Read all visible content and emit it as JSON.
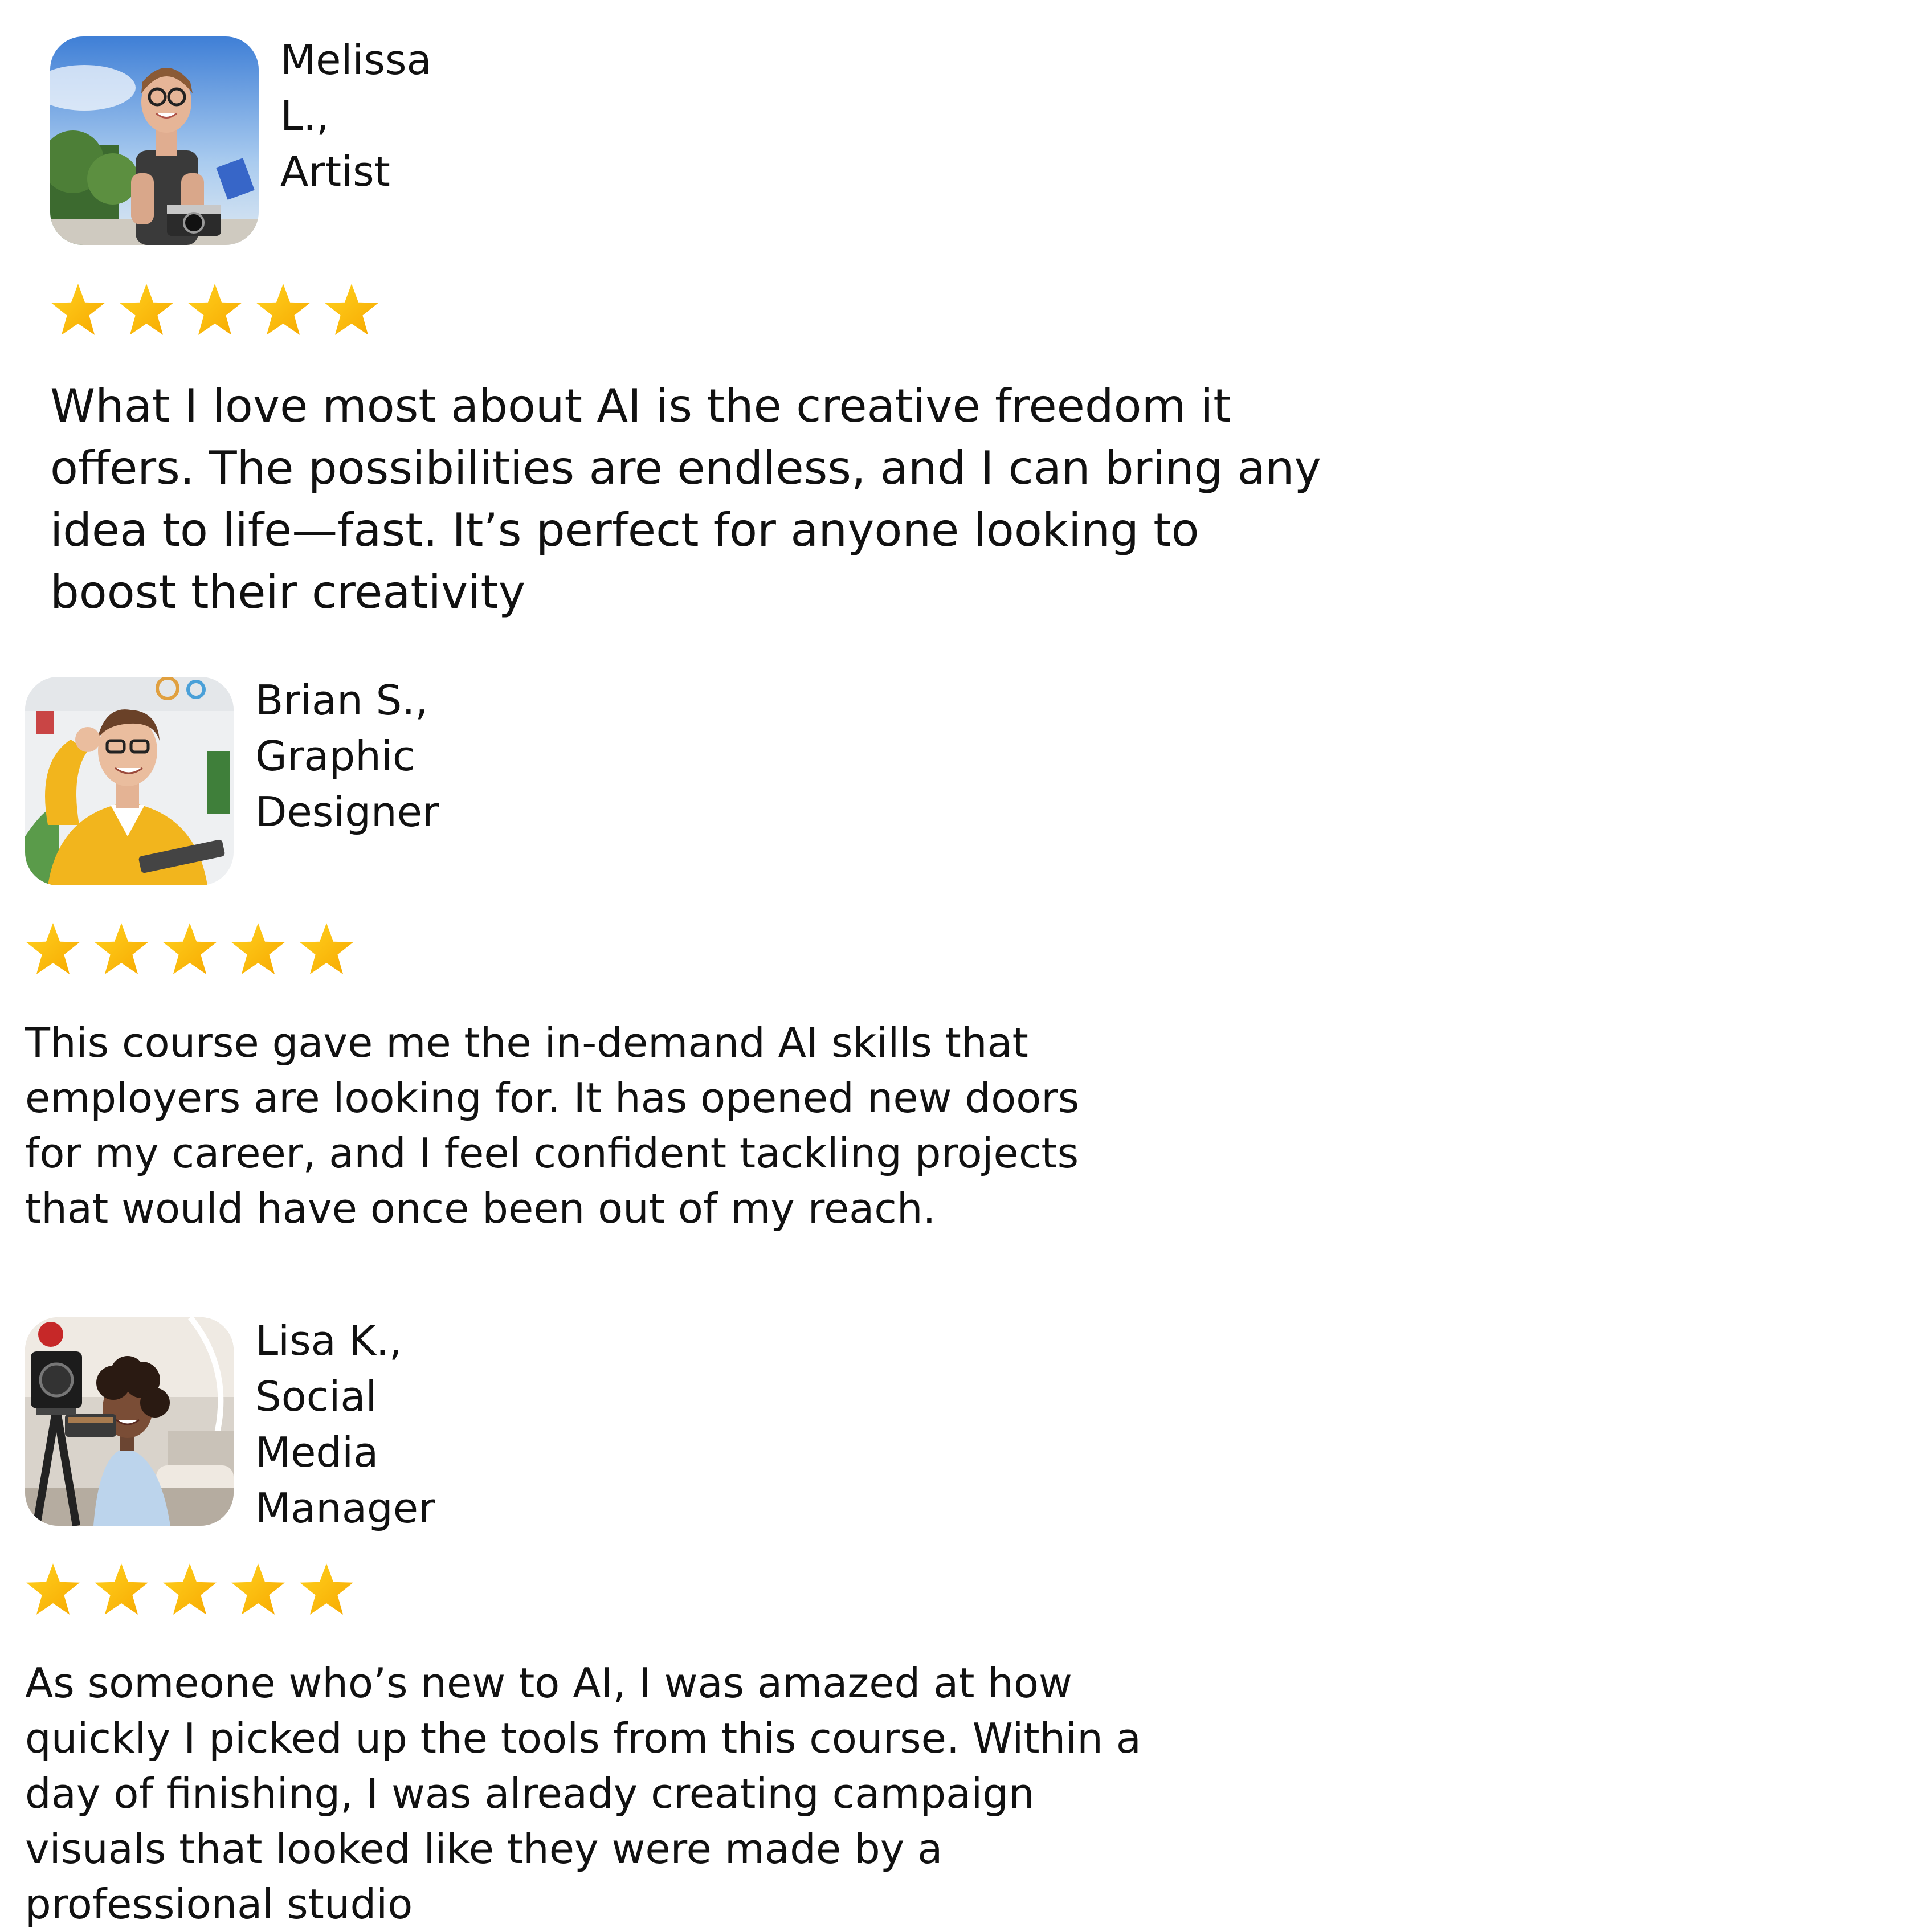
{
  "colors": {
    "background": "#ffffff",
    "text": "#111111",
    "star_light": "#ffd21f",
    "star_dark": "#f7a800"
  },
  "testimonials": [
    {
      "name": "Melissa L., Artist",
      "rating": 5,
      "review": "What I love most about AI is the creative freedom it offers. The possibilities are endless, and I can bring any idea to life—fast. It’s perfect for anyone looking to boost their creativity",
      "avatar": "woman-with-camera-photo"
    },
    {
      "name": "Brian S., Graphic\nDesigner",
      "rating": 5,
      "review": "This course gave me the in-demand AI skills that employers are looking for. It has opened new doors for my career, and I feel confident tackling projects that would have once been out of my reach.",
      "avatar": "man-with-glasses-photo"
    },
    {
      "name": "Lisa K., Social Media\nManager",
      "rating": 5,
      "review": "As someone who’s new to AI, I was amazed at how quickly I picked up the tools from this course. Within a day of finishing, I was already creating campaign visuals that looked like they were made by a professional studio",
      "avatar": "woman-filming-video-photo"
    }
  ]
}
